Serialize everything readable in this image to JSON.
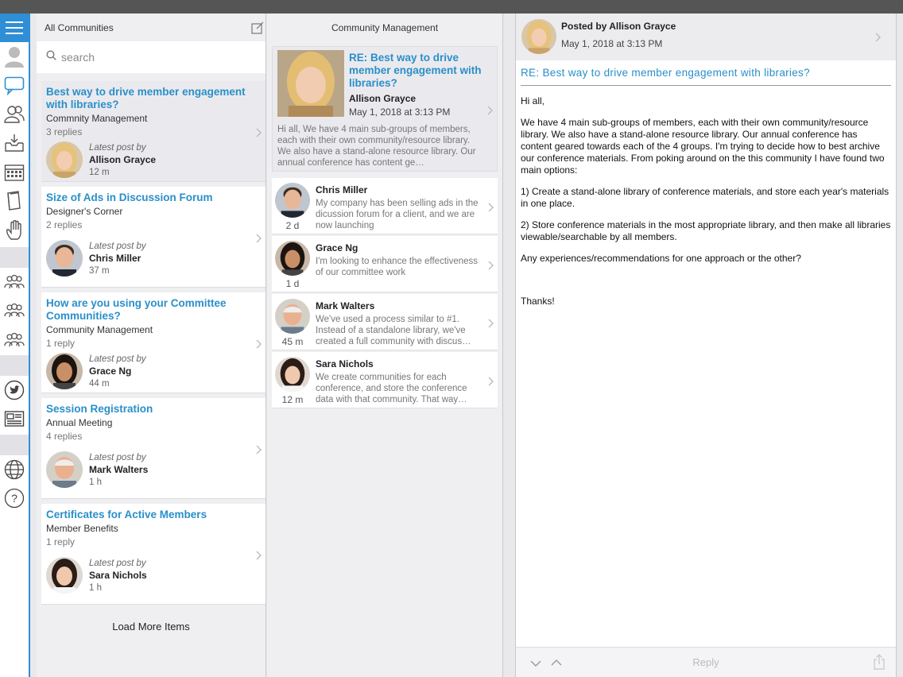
{
  "col1": {
    "header": "All Communities",
    "search_placeholder": "search",
    "threads": [
      {
        "title": "Best way to drive member engagement with libraries?",
        "community": "Commnity Management",
        "replies": "3 replies",
        "latest_label": "Latest post by",
        "author": "Allison Grayce",
        "time": "12 m"
      },
      {
        "title": "Size of Ads in Discussion Forum",
        "community": "Designer's Corner",
        "replies": "2 replies",
        "latest_label": "Latest post by",
        "author": "Chris Miller",
        "time": "37 m"
      },
      {
        "title": "How are you using your Committee Communities?",
        "community": "Community Management",
        "replies": "1 reply",
        "latest_label": "Latest post by",
        "author": "Grace Ng",
        "time": "44 m"
      },
      {
        "title": "Session Registration",
        "community": "Annual Meeting",
        "replies": "4 replies",
        "latest_label": "Latest post by",
        "author": "Mark Walters",
        "time": "1 h"
      },
      {
        "title": "Certificates for Active Members",
        "community": "Member Benefits",
        "replies": "1 reply",
        "latest_label": "Latest post by",
        "author": "Sara Nichols",
        "time": "1 h"
      }
    ],
    "load_more": "Load More Items"
  },
  "col2": {
    "header": "Community Management",
    "original": {
      "title": "RE: Best way to drive member engagement with libraries?",
      "author": "Allison Grayce",
      "date": "May 1, 2018 at 3:13 PM",
      "excerpt": "Hi all, We have 4 main sub-groups of members, each with their own community/resource library. We also have a stand-alone resource library. Our annual conference has content ge…"
    },
    "replies": [
      {
        "author": "Chris Miller",
        "age": "2 d",
        "text": "My company has been selling ads in the dicussion forum for a client, and we are now launching"
      },
      {
        "author": "Grace Ng",
        "age": "1 d",
        "text": "I'm looking to enhance the effectiveness of our committee work"
      },
      {
        "author": "Mark Walters",
        "age": "45 m",
        "text": "We've used a process similar to #1. Instead of a standalone library, we've created a full community with discus…"
      },
      {
        "author": "Sara Nichols",
        "age": "12 m",
        "text": "We create communities for each conference, and store the conference data with that community.  That way…"
      }
    ]
  },
  "col3": {
    "posted_by": "Posted by Allison Grayce",
    "date": "May 1, 2018 at 3:13 PM",
    "subject": "RE: Best way to drive member engagement with libraries?",
    "body": [
      "Hi all,",
      "We have 4 main sub-groups of members, each with their own community/resource library.  We also have a stand-alone resource library.  Our annual conference has content geared towards each of the 4 groups.  I'm trying to decide how to best archive our conference materials.  From poking around on the this community I have found two main options:",
      "1) Create a stand-alone library of conference materials, and store each year's materials in one place.",
      "2) Store conference materials in the most appropriate library, and then make all libraries viewable/searchable by all members.",
      "Any experiences/recommendations for one approach or the other?",
      "",
      "Thanks!"
    ],
    "reply_label": "Reply"
  },
  "icons": {
    "rail": [
      "menu-icon",
      "profile-icon",
      "chat-bubble-icon",
      "people-icon",
      "inbox-icon",
      "calendar-icon",
      "book-icon",
      "hand-icon",
      "group-icon",
      "group-icon",
      "group-icon",
      "twitter-icon",
      "news-icon",
      "globe-icon",
      "help-icon"
    ]
  },
  "colors": {
    "accent": "#2f8fd6",
    "link": "#2a8fc9"
  }
}
